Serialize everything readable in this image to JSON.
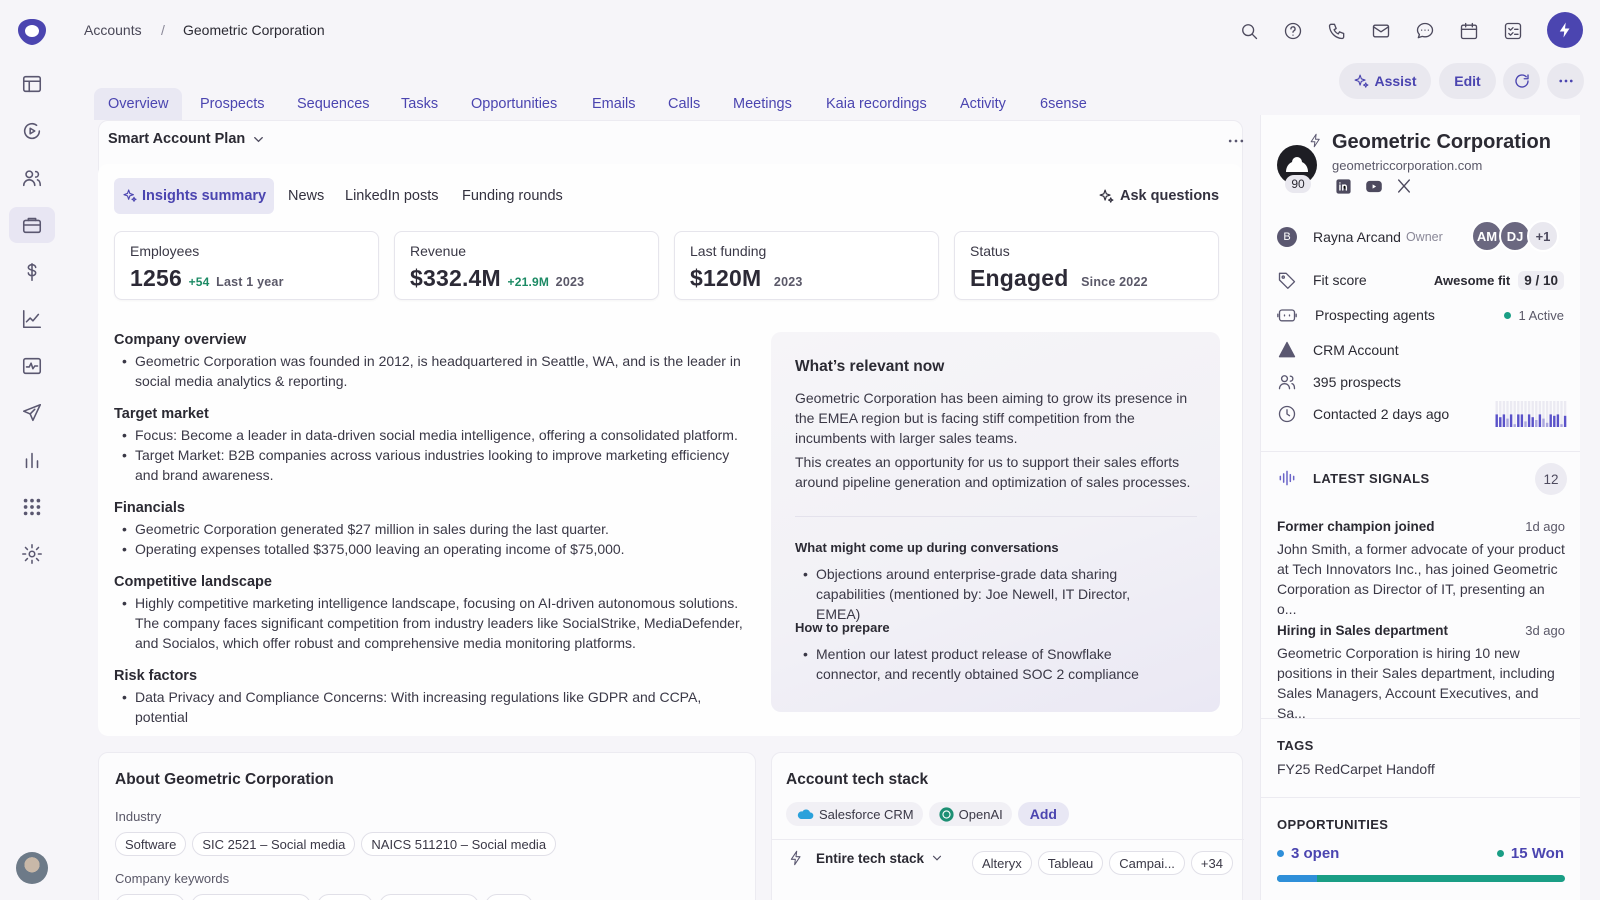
{
  "breadcrumb": {
    "parent": "Accounts",
    "separator": "/",
    "current": "Geometric Corporation"
  },
  "header_actions": {
    "assist": "Assist",
    "edit": "Edit"
  },
  "tabs": [
    "Overview",
    "Prospects",
    "Sequences",
    "Tasks",
    "Opportunities",
    "Emails",
    "Calls",
    "Meetings",
    "Kaia recordings",
    "Activity",
    "6sense"
  ],
  "plan": {
    "title": "Smart Account Plan",
    "subtabs": [
      "Insights summary",
      "News",
      "LinkedIn posts",
      "Funding rounds"
    ],
    "ask": "Ask questions",
    "stats": [
      {
        "label": "Employees",
        "value": "1256",
        "delta": "+54",
        "note": "Last 1 year"
      },
      {
        "label": "Revenue",
        "value": "$332.4M",
        "delta": "+21.9M",
        "note": "2023"
      },
      {
        "label": "Last funding",
        "value": "$120M",
        "delta": "",
        "note": "2023"
      },
      {
        "label": "Status",
        "value": "Engaged",
        "delta": "",
        "note": "Since 2022"
      }
    ],
    "overview": {
      "h1": "Company overview",
      "b1": "Geometric Corporation was founded in 2012, is headquartered in Seattle, WA, and is the leader in social media analytics & reporting.",
      "h2": "Target market",
      "b2a": "Focus: Become a leader in data-driven social media intelligence, offering a consolidated platform.",
      "b2b": "Target Market: B2B companies across various industries looking to improve marketing efficiency and brand awareness.",
      "h3": "Financials",
      "b3a": "Geometric Corporation generated $27 million in sales during the last quarter.",
      "b3b": "Operating expenses totalled $375,000 leaving an operating income of $75,000.",
      "h4": "Competitive landscape",
      "b4": "Highly competitive marketing intelligence landscape, focusing on AI-driven autonomous solutions. The company faces significant competition from industry leaders like SocialStrike, MediaDefender, and Socialos, which offer robust and comprehensive media monitoring platforms.",
      "h5": "Risk factors",
      "b5": "Data Privacy and Compliance Concerns: With increasing regulations like GDPR and CCPA, potential"
    },
    "relevant": {
      "title": "What’s relevant now",
      "p1": "Geometric Corporation has been aiming to grow its presence in the EMEA region but is facing stiff competition from the incumbents with larger sales teams.",
      "p2": "This creates an opportunity for us to support their sales efforts around pipeline generation and optimization of sales processes.",
      "h1": "What might come up during conversations",
      "b1": "Objections around enterprise-grade data sharing capabilities (mentioned by: Joe Newell, IT Director, EMEA)",
      "h2": "How to prepare",
      "b2": "Mention our latest product release of Snowflake connector, and recently obtained SOC 2 compliance"
    }
  },
  "about": {
    "title": "About Geometric Corporation",
    "industry_label": "Industry",
    "industry_chips": [
      "Software",
      "SIC 2521 – Social media",
      "NAICS 511210 – Social media"
    ],
    "keywords_label": "Company keywords"
  },
  "techstack": {
    "title": "Account tech stack",
    "items": [
      "Salesforce CRM",
      "OpenAI"
    ],
    "add": "Add",
    "filter": "Entire tech stack",
    "chips": [
      "Alteryx",
      "Tableau",
      "Campai...",
      "+34"
    ]
  },
  "account": {
    "name": "Geometric Corporation",
    "domain": "geometriccorporation.com",
    "score": "90",
    "owner_initial": "B",
    "owner": "Rayna Arcand",
    "owner_role": "Owner",
    "avatars": [
      "AM",
      "DJ",
      "+1"
    ],
    "fit_label": "Fit score",
    "fit_text": "Awesome fit",
    "fit_value": "9 / 10",
    "agents_label": "Prospecting agents",
    "agents_status": "1 Active",
    "crm": "CRM Account",
    "prospects": "395 prospects",
    "contacted": "Contacted 2 days ago",
    "activity_levels": [
      0.9,
      0.7,
      0.9,
      0.6,
      0.9,
      0.2,
      0.9,
      0.9,
      0.4,
      0.9,
      0.7,
      0.5,
      0.9,
      0.6,
      0.3,
      0.9,
      0.8,
      0.9,
      0.2,
      0.8
    ],
    "signals_label": "LATEST SIGNALS",
    "signals_count": "12",
    "signals": [
      {
        "title": "Former champion joined",
        "ago": "1d ago",
        "body": "John Smith, a former advocate of your product at Tech Innovators Inc., has joined Geometric Corporation as Director of IT, presenting an o..."
      },
      {
        "title": "Hiring in Sales department",
        "ago": "3d ago",
        "body": "Geometric Corporation is hiring 10 new positions in their Sales department, including Sales Managers, Account Executives, and Sa..."
      }
    ],
    "tags_label": "TAGS",
    "tag": "FY25 RedCarpet Handoff",
    "opps_label": "OPPORTUNITIES",
    "opps_open": "3 open",
    "opps_won": "15 Won",
    "opps_open_share": 0.14,
    "colors": {
      "accent": "#4b45b0",
      "won": "#1a9e85",
      "open": "#2f8fd9"
    }
  }
}
